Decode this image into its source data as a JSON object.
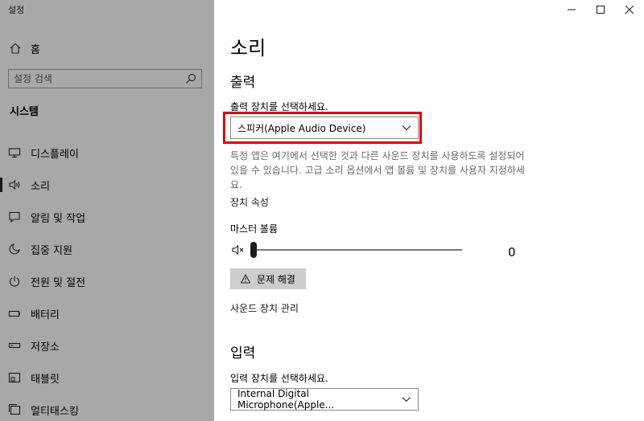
{
  "window": {
    "title": "설정",
    "controls": {
      "minimize": "—",
      "maximize": "☐",
      "close": "✕"
    }
  },
  "sidebar": {
    "home_label": "홈",
    "search_placeholder": "설정 검색",
    "section_title": "시스템",
    "items": [
      {
        "label": "디스플레이",
        "icon": "monitor-icon"
      },
      {
        "label": "소리",
        "icon": "speaker-icon",
        "active": true
      },
      {
        "label": "알림 및 작업",
        "icon": "notification-icon"
      },
      {
        "label": "집중 지원",
        "icon": "moon-icon"
      },
      {
        "label": "전원 및 절전",
        "icon": "power-icon"
      },
      {
        "label": "배터리",
        "icon": "battery-icon"
      },
      {
        "label": "저장소",
        "icon": "storage-icon"
      },
      {
        "label": "태블릿",
        "icon": "tablet-icon"
      },
      {
        "label": "멀티태스킹",
        "icon": "multitasking-icon"
      }
    ]
  },
  "main": {
    "page_title": "소리",
    "output": {
      "heading": "출력",
      "select_label": "출력 장치를 선택하세요.",
      "selected_device": "스피커(Apple Audio Device)",
      "description": "특정 앱은 여기에서 선택한 것과 다른 사운드 장치를 사용하도록 설정되어 있을 수 있습니다. 고급 소리 옵션에서 앱 볼륨 및 장치를 사용자 지정하세요.",
      "device_properties": "장치 속성",
      "master_volume_label": "마스터 볼륨",
      "volume_value": "0",
      "troubleshoot_label": "문제 해결",
      "manage_devices": "사운드 장치 관리"
    },
    "input": {
      "heading": "입력",
      "select_label": "입력 장치를 선택하세요.",
      "selected_device": "Internal Digital Microphone(Apple..."
    }
  },
  "colors": {
    "sidebar_bg": "#a8a8a8",
    "highlight": "#e00000",
    "button_bg": "#cccccc"
  }
}
